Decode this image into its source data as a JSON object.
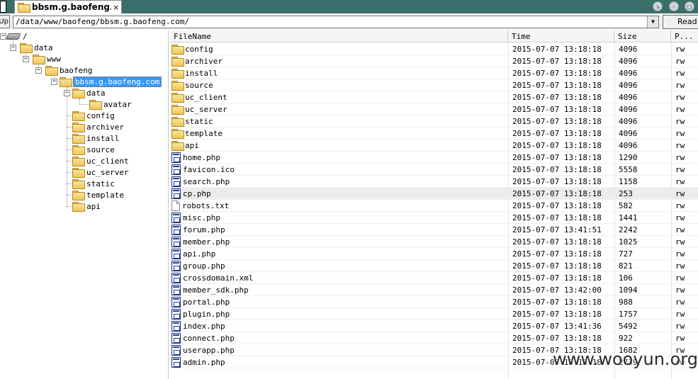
{
  "window": {
    "tab_title": "bbsm.g.baofeng.c...",
    "tab_close": "×"
  },
  "toolbar": {
    "up_label": "Up",
    "path_value": "/data/www/baofeng/bbsm.g.baofeng.com/",
    "read_label": "Read"
  },
  "tree": {
    "root": "/",
    "data": "data",
    "www": "www",
    "baofeng": "baofeng",
    "selected": "bbsm.g.baofeng.com",
    "children": [
      "data",
      "config",
      "archiver",
      "install",
      "source",
      "uc_client",
      "uc_server",
      "static",
      "template",
      "api"
    ],
    "grandchild": "avatar"
  },
  "list": {
    "columns": {
      "name": "FileName",
      "time": "Time",
      "size": "Size",
      "perm": "P..."
    },
    "rows": [
      {
        "name": "config",
        "time": "2015-07-07 13:18:18",
        "size": "4096",
        "perm": "rw",
        "type": "folder"
      },
      {
        "name": "archiver",
        "time": "2015-07-07 13:18:18",
        "size": "4096",
        "perm": "rw",
        "type": "folder"
      },
      {
        "name": "install",
        "time": "2015-07-07 13:18:18",
        "size": "4096",
        "perm": "rw",
        "type": "folder"
      },
      {
        "name": "source",
        "time": "2015-07-07 13:18:18",
        "size": "4096",
        "perm": "rw",
        "type": "folder"
      },
      {
        "name": "uc_client",
        "time": "2015-07-07 13:18:18",
        "size": "4096",
        "perm": "rw",
        "type": "folder"
      },
      {
        "name": "uc_server",
        "time": "2015-07-07 13:18:18",
        "size": "4096",
        "perm": "rw",
        "type": "folder"
      },
      {
        "name": "static",
        "time": "2015-07-07 13:18:18",
        "size": "4096",
        "perm": "rw",
        "type": "folder"
      },
      {
        "name": "template",
        "time": "2015-07-07 13:18:18",
        "size": "4096",
        "perm": "rw",
        "type": "folder"
      },
      {
        "name": "api",
        "time": "2015-07-07 13:18:18",
        "size": "4096",
        "perm": "rw",
        "type": "folder"
      },
      {
        "name": "home.php",
        "time": "2015-07-07 13:18:18",
        "size": "1290",
        "perm": "rw",
        "type": "php"
      },
      {
        "name": "favicon.ico",
        "time": "2015-07-07 13:18:18",
        "size": "5558",
        "perm": "rw",
        "type": "php"
      },
      {
        "name": "search.php",
        "time": "2015-07-07 13:18:18",
        "size": "1158",
        "perm": "rw",
        "type": "php"
      },
      {
        "name": "cp.php",
        "time": "2015-07-07 13:18:18",
        "size": "253",
        "perm": "rw",
        "type": "php",
        "highlight": true
      },
      {
        "name": "robots.txt",
        "time": "2015-07-07 13:18:18",
        "size": "582",
        "perm": "rw",
        "type": "txt"
      },
      {
        "name": "misc.php",
        "time": "2015-07-07 13:18:18",
        "size": "1441",
        "perm": "rw",
        "type": "php"
      },
      {
        "name": "forum.php",
        "time": "2015-07-07 13:41:51",
        "size": "2242",
        "perm": "rw",
        "type": "php"
      },
      {
        "name": "member.php",
        "time": "2015-07-07 13:18:18",
        "size": "1025",
        "perm": "rw",
        "type": "php"
      },
      {
        "name": "api.php",
        "time": "2015-07-07 13:18:18",
        "size": "727",
        "perm": "rw",
        "type": "php"
      },
      {
        "name": "group.php",
        "time": "2015-07-07 13:18:18",
        "size": "821",
        "perm": "rw",
        "type": "php"
      },
      {
        "name": "crossdomain.xml",
        "time": "2015-07-07 13:18:18",
        "size": "106",
        "perm": "rw",
        "type": "php"
      },
      {
        "name": "member_sdk.php",
        "time": "2015-07-07 13:42:00",
        "size": "1094",
        "perm": "rw",
        "type": "php"
      },
      {
        "name": "portal.php",
        "time": "2015-07-07 13:18:18",
        "size": "988",
        "perm": "rw",
        "type": "php"
      },
      {
        "name": "plugin.php",
        "time": "2015-07-07 13:18:18",
        "size": "1757",
        "perm": "rw",
        "type": "php"
      },
      {
        "name": "index.php",
        "time": "2015-07-07 13:41:36",
        "size": "5492",
        "perm": "rw",
        "type": "php"
      },
      {
        "name": "connect.php",
        "time": "2015-07-07 13:18:18",
        "size": "922",
        "perm": "rw",
        "type": "php"
      },
      {
        "name": "userapp.php",
        "time": "2015-07-07 13:18:18",
        "size": "1682",
        "perm": "rw",
        "type": "php"
      },
      {
        "name": "admin.php",
        "time": "2015-07-07 13:18:18",
        "size": "2739",
        "perm": "rw",
        "type": "php"
      }
    ]
  },
  "watermark": "www.wooyun.org"
}
